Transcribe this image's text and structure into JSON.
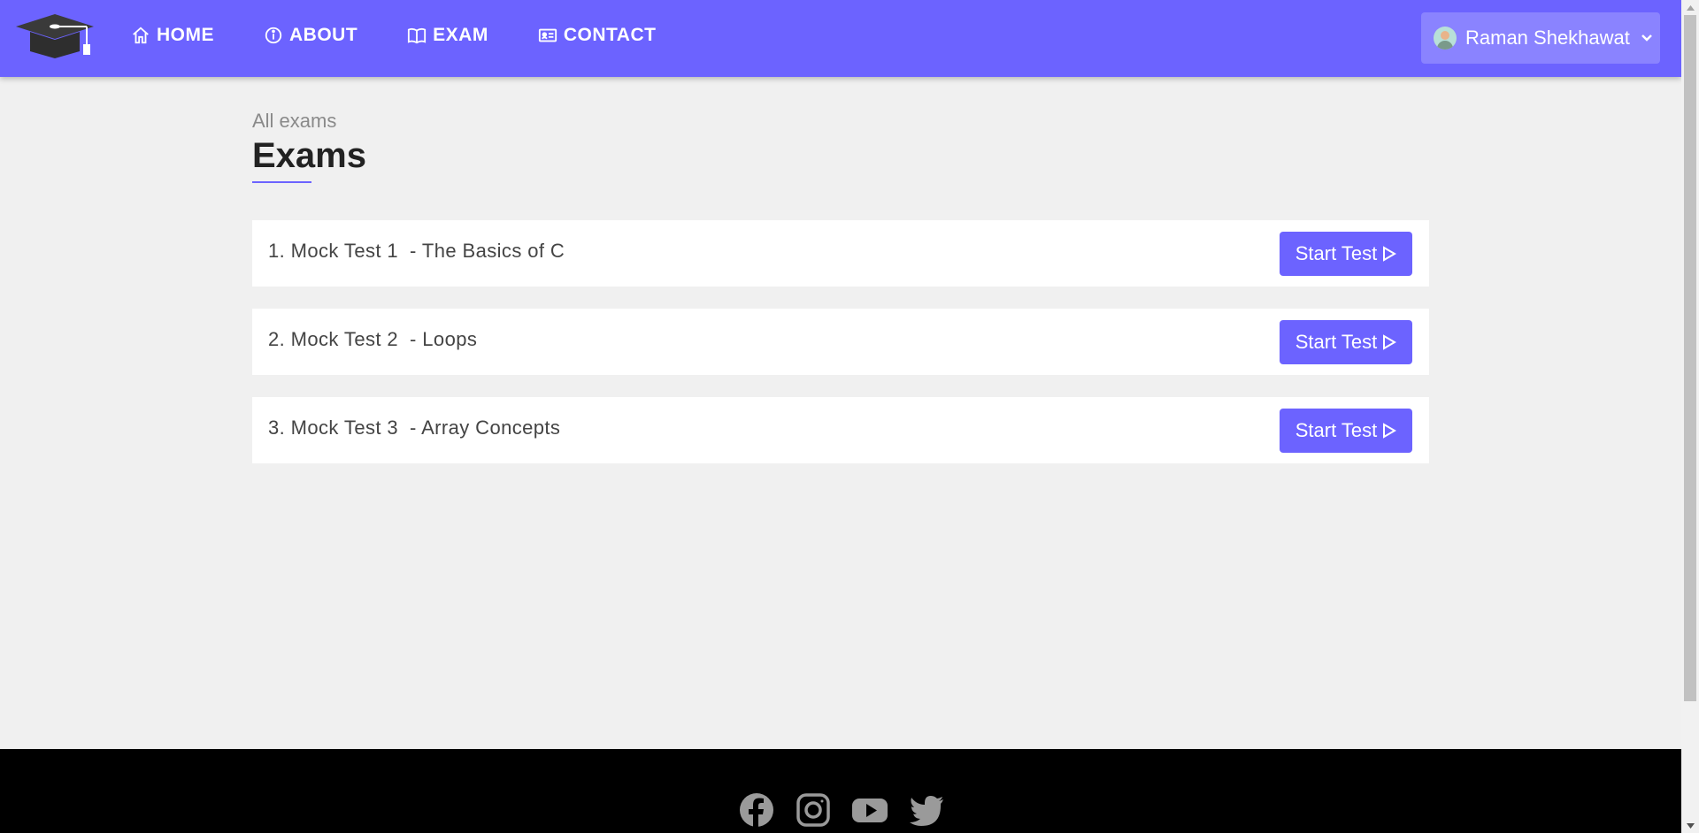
{
  "nav": {
    "links": [
      {
        "label": "HOME",
        "icon": "home-icon"
      },
      {
        "label": "ABOUT",
        "icon": "info-icon"
      },
      {
        "label": "EXAM",
        "icon": "book-icon"
      },
      {
        "label": "CONTACT",
        "icon": "id-card-icon"
      }
    ],
    "user_name": "Raman Shekhawat"
  },
  "page": {
    "breadcrumb": "All exams",
    "title": "Exams"
  },
  "exams": [
    {
      "label": "1. Mock Test 1  - The Basics of C",
      "button": "Start Test"
    },
    {
      "label": "2. Mock Test 2  - Loops",
      "button": "Start Test"
    },
    {
      "label": "3. Mock Test 3  - Array Concepts",
      "button": "Start Test"
    }
  ],
  "footer": {
    "socials": [
      "facebook-icon",
      "instagram-icon",
      "youtube-icon",
      "twitter-icon"
    ]
  },
  "colors": {
    "brand": "#6c63ff",
    "user_menu_bg": "#8a83ff",
    "page_bg": "#f0f0f0",
    "footer_bg": "#000000"
  }
}
